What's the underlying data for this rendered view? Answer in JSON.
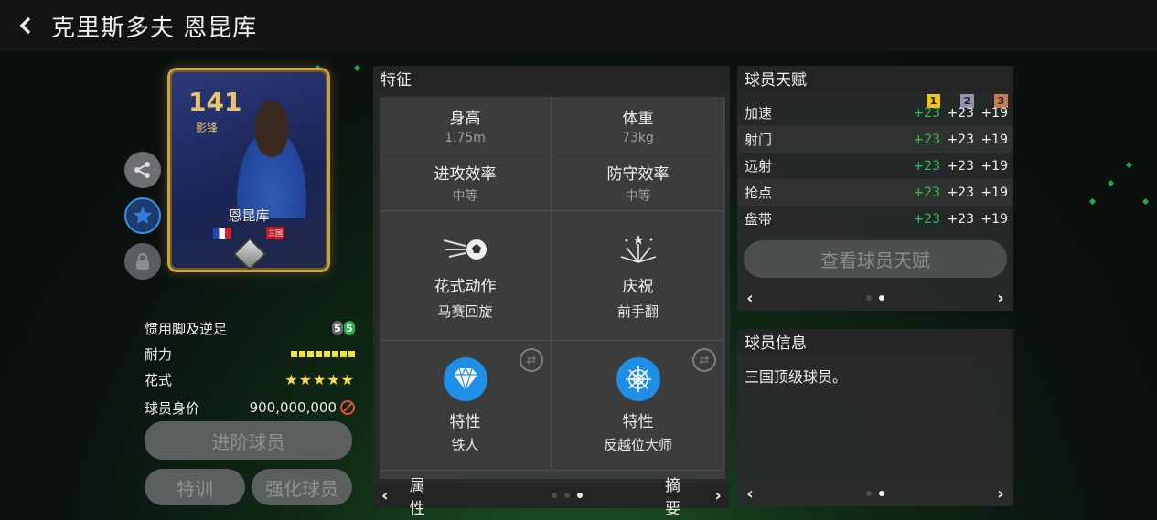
{
  "header": {
    "title": "克里斯多夫 恩昆库"
  },
  "card": {
    "rating": "141",
    "position": "影锋",
    "name": "恩昆库",
    "club_badge": "三国"
  },
  "stats": {
    "foot": {
      "label": "惯用脚及逆足",
      "badge1": "5",
      "badge2": "5"
    },
    "stamina": {
      "label": "耐力"
    },
    "skill": {
      "label": "花式",
      "stars": "★★★★★"
    },
    "value": {
      "label": "球员身价",
      "amount": "900,000,000"
    }
  },
  "buttons": {
    "advance": "进阶球员",
    "train": "特训",
    "enhance": "强化球员"
  },
  "traits": {
    "title": "特征",
    "height": {
      "label": "身高",
      "value": "1.75m"
    },
    "weight": {
      "label": "体重",
      "value": "73kg"
    },
    "attack": {
      "label": "进攻效率",
      "value": "中等"
    },
    "defense": {
      "label": "防守效率",
      "value": "中等"
    },
    "skill_move": {
      "label": "花式动作",
      "value": "马赛回旋"
    },
    "celebration": {
      "label": "庆祝",
      "value": "前手翻"
    },
    "trait1": {
      "label": "特性",
      "value": "铁人"
    },
    "trait2": {
      "label": "特性",
      "value": "反越位大师"
    },
    "footer": {
      "left": "属性",
      "right": "摘要"
    }
  },
  "talent": {
    "title": "球员天赋",
    "tiers": [
      "1",
      "2",
      "3"
    ],
    "rows": [
      {
        "name": "加速",
        "v1": "+23",
        "v2": "+23",
        "v3": "+19"
      },
      {
        "name": "射门",
        "v1": "+23",
        "v2": "+23",
        "v3": "+19"
      },
      {
        "name": "远射",
        "v1": "+23",
        "v2": "+23",
        "v3": "+19"
      },
      {
        "name": "抢点",
        "v1": "+23",
        "v2": "+23",
        "v3": "+19"
      },
      {
        "name": "盘带",
        "v1": "+23",
        "v2": "+23",
        "v3": "+19"
      }
    ],
    "view_button": "查看球员天赋"
  },
  "info": {
    "title": "球员信息",
    "text": "三国顶级球员。"
  },
  "colors": {
    "accent_green": "#2fbf54",
    "card_gold": "#c8a24b",
    "panel_bg": "#282a2a"
  }
}
